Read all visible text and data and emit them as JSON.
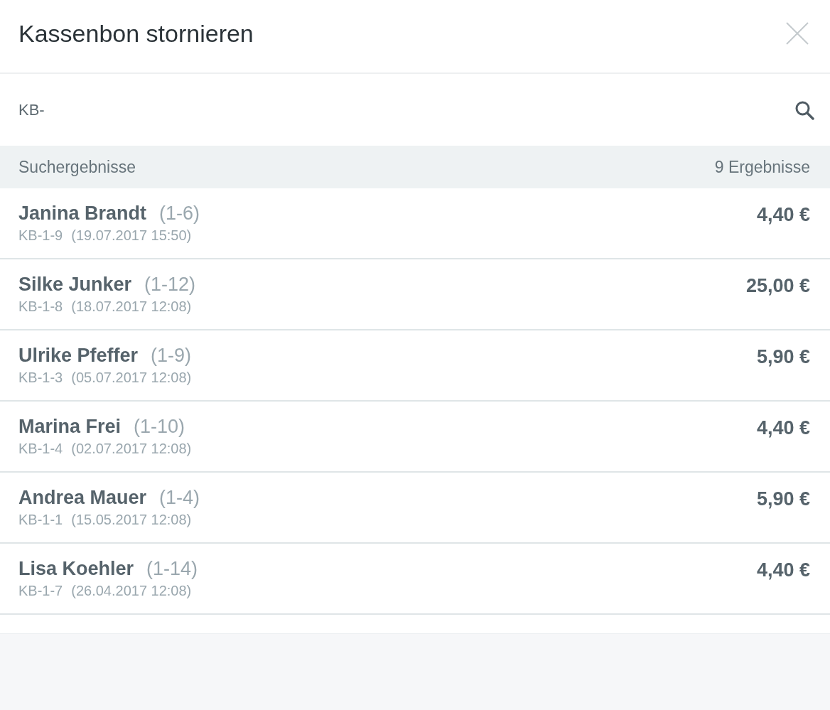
{
  "dialog": {
    "title": "Kassenbon stornieren"
  },
  "search": {
    "value": "KB-"
  },
  "results_header": {
    "label": "Suchergebnisse",
    "count": "9 Ergebnisse"
  },
  "results": [
    {
      "name": "Janina Brandt",
      "code": "(1-6)",
      "receipt": "KB-1-9",
      "date": "(19.07.2017 15:50)",
      "amount": "4,40 €"
    },
    {
      "name": "Silke Junker",
      "code": "(1-12)",
      "receipt": "KB-1-8",
      "date": "(18.07.2017 12:08)",
      "amount": "25,00 €"
    },
    {
      "name": "Ulrike Pfeffer",
      "code": "(1-9)",
      "receipt": "KB-1-3",
      "date": "(05.07.2017 12:08)",
      "amount": "5,90 €"
    },
    {
      "name": "Marina Frei",
      "code": "(1-10)",
      "receipt": "KB-1-4",
      "date": "(02.07.2017 12:08)",
      "amount": "4,40 €"
    },
    {
      "name": "Andrea Mauer",
      "code": "(1-4)",
      "receipt": "KB-1-1",
      "date": "(15.05.2017 12:08)",
      "amount": "5,90 €"
    },
    {
      "name": "Lisa Koehler",
      "code": "(1-14)",
      "receipt": "KB-1-7",
      "date": "(26.04.2017 12:08)",
      "amount": "4,40 €"
    }
  ]
}
